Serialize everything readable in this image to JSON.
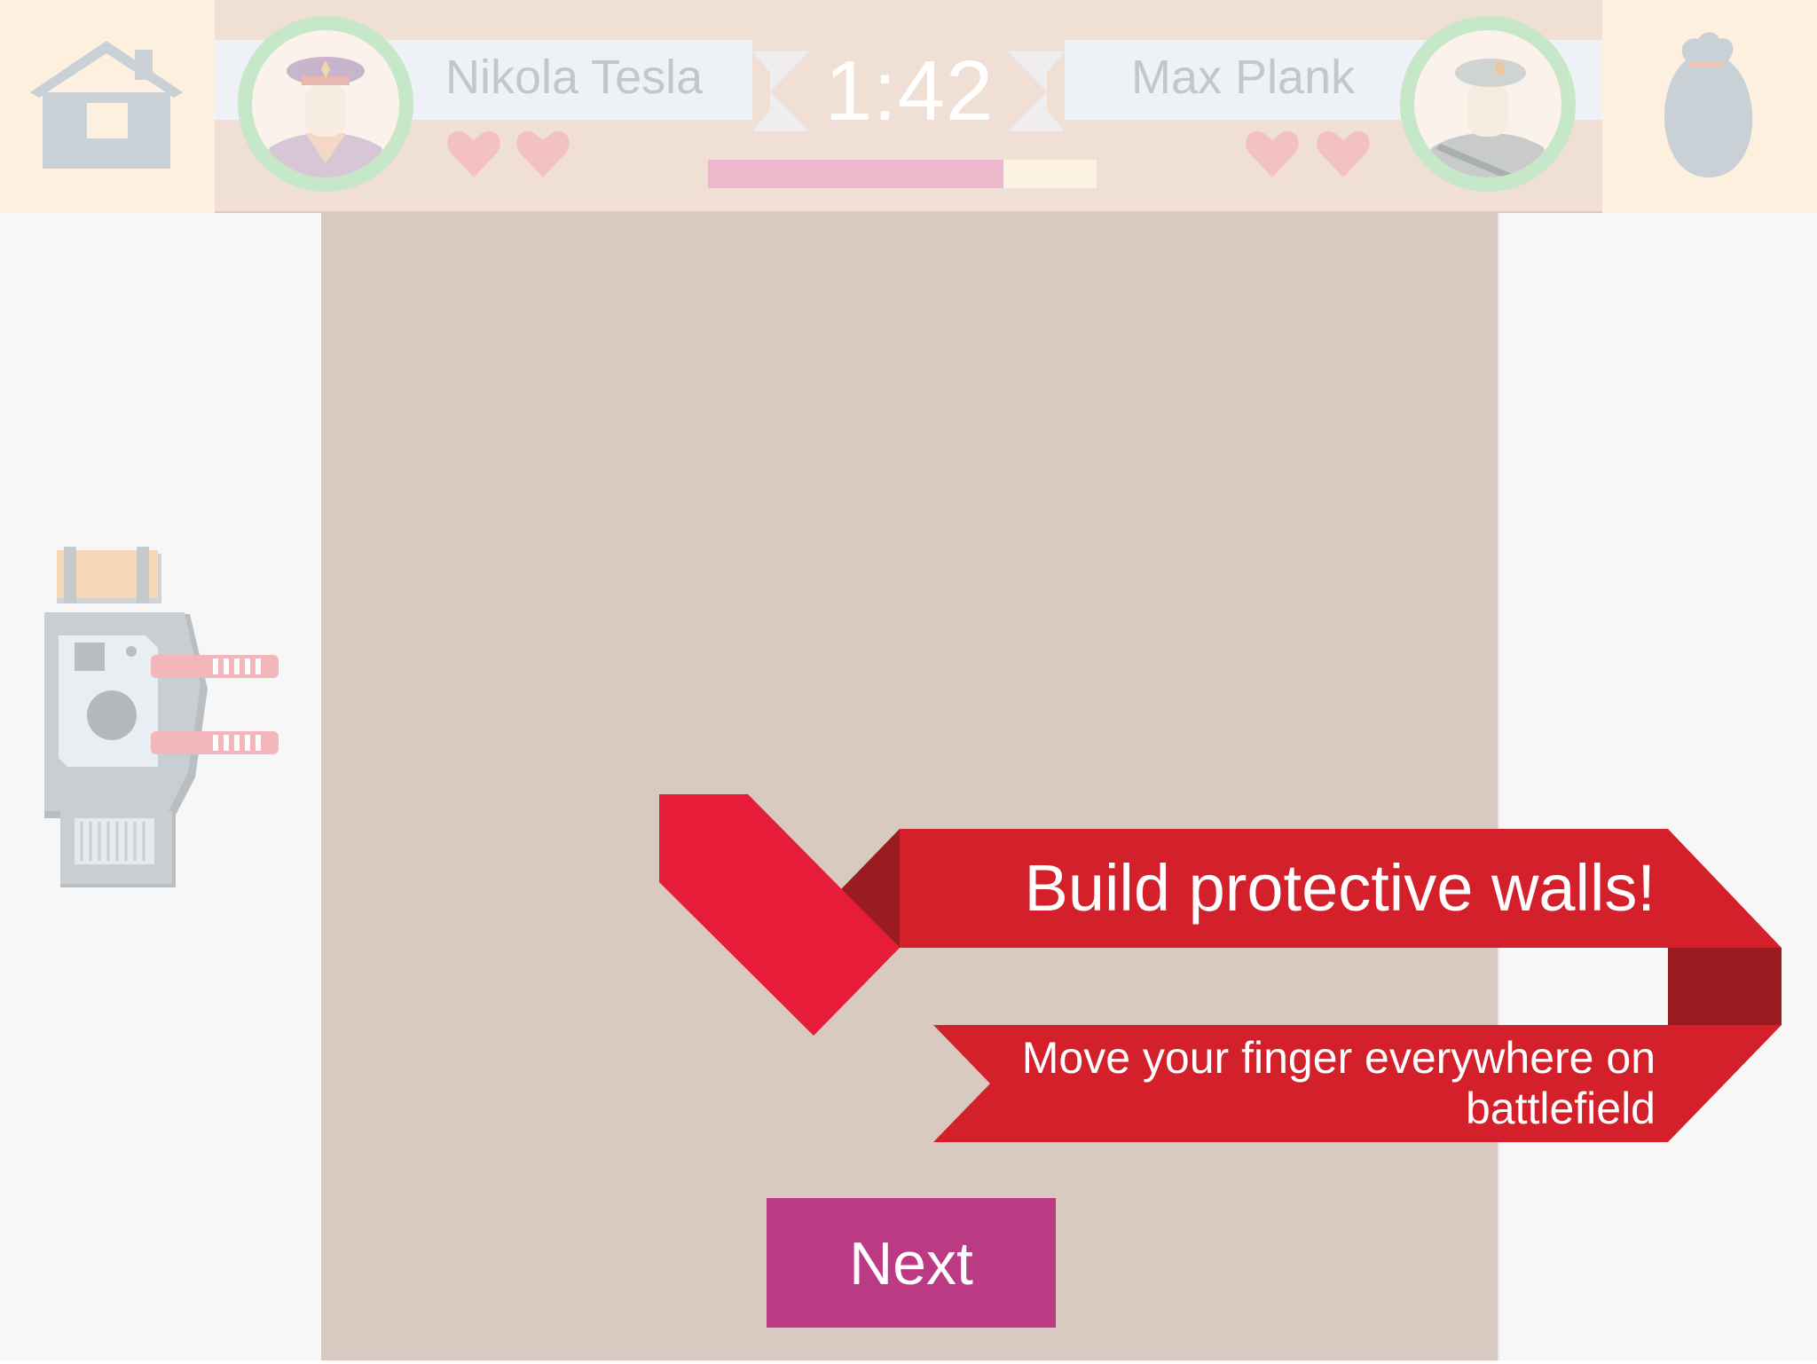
{
  "header": {
    "home_icon": "home-icon",
    "bag_icon": "money-bag-icon",
    "player_left": {
      "name": "Nikola Tesla",
      "lives": 2,
      "avatar_icon": "officer-avatar-icon"
    },
    "player_right": {
      "name": "Max Plank",
      "lives": 2,
      "avatar_icon": "soldier-avatar-icon"
    },
    "timer": "1:42",
    "timer_progress": 0.76
  },
  "tutorial": {
    "title": "Build protective walls!",
    "subtitle": "Move your finger everywhere on battlefield",
    "next_label": "Next"
  },
  "colors": {
    "ribbon_red": "#d4202a",
    "ribbon_dark": "#9c1b20",
    "check_red": "#e61c38",
    "next_button": "#bb3a84",
    "battlefield": "#d8cac1",
    "heart": "#f3c0c4",
    "avatar_ring": "#c6e7c8"
  }
}
